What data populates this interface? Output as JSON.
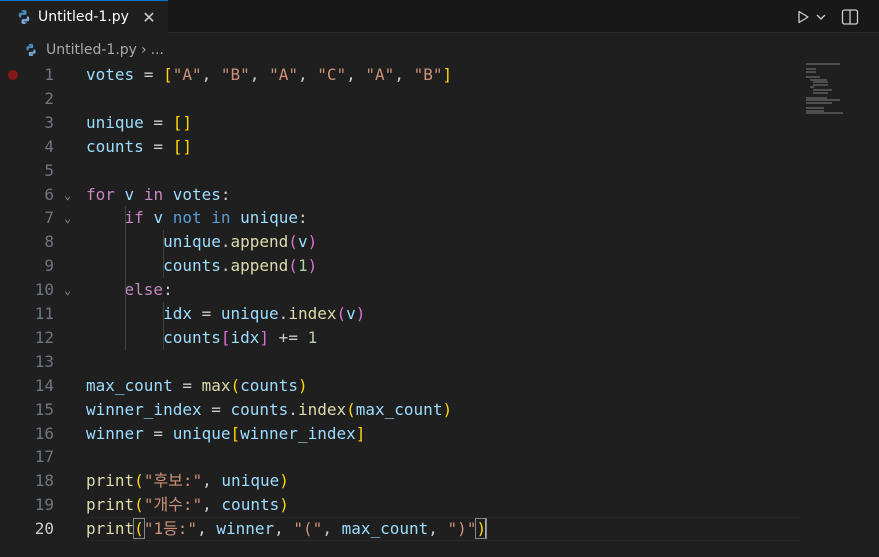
{
  "tab": {
    "title": "Untitled-1.py",
    "close_glyph": "✕",
    "active": true
  },
  "breadcrumb": {
    "file": "Untitled-1.py",
    "separator": "›",
    "more": "..."
  },
  "colors": {
    "accent": "#0078d4",
    "breakpoint": "#851818",
    "editor_bg": "#1f1f1f"
  },
  "icons": [
    "python-file-icon",
    "run-icon",
    "chevron-down-icon",
    "split-editor-icon",
    "close-icon",
    "fold-chevron-icon"
  ],
  "editor": {
    "breakpoint_line": 1,
    "current_line": 20,
    "lines": [
      {
        "n": "1",
        "fold": ""
      },
      {
        "n": "2",
        "fold": ""
      },
      {
        "n": "3",
        "fold": ""
      },
      {
        "n": "4",
        "fold": ""
      },
      {
        "n": "5",
        "fold": ""
      },
      {
        "n": "6",
        "fold": "⌄"
      },
      {
        "n": "7",
        "fold": "⌄"
      },
      {
        "n": "8",
        "fold": ""
      },
      {
        "n": "9",
        "fold": ""
      },
      {
        "n": "10",
        "fold": "⌄"
      },
      {
        "n": "11",
        "fold": ""
      },
      {
        "n": "12",
        "fold": ""
      },
      {
        "n": "13",
        "fold": ""
      },
      {
        "n": "14",
        "fold": ""
      },
      {
        "n": "15",
        "fold": ""
      },
      {
        "n": "16",
        "fold": ""
      },
      {
        "n": "17",
        "fold": ""
      },
      {
        "n": "18",
        "fold": ""
      },
      {
        "n": "19",
        "fold": ""
      },
      {
        "n": "20",
        "fold": ""
      }
    ],
    "code": [
      [
        [
          "var",
          "votes"
        ],
        [
          "p",
          " = "
        ],
        [
          "b1",
          "["
        ],
        [
          "str",
          "\"A\""
        ],
        [
          "p",
          ", "
        ],
        [
          "str",
          "\"B\""
        ],
        [
          "p",
          ", "
        ],
        [
          "str",
          "\"A\""
        ],
        [
          "p",
          ", "
        ],
        [
          "str",
          "\"C\""
        ],
        [
          "p",
          ", "
        ],
        [
          "str",
          "\"A\""
        ],
        [
          "p",
          ", "
        ],
        [
          "str",
          "\"B\""
        ],
        [
          "b1",
          "]"
        ]
      ],
      [],
      [
        [
          "var",
          "unique"
        ],
        [
          "p",
          " = "
        ],
        [
          "b1",
          "[]"
        ]
      ],
      [
        [
          "var",
          "counts"
        ],
        [
          "p",
          " = "
        ],
        [
          "b1",
          "[]"
        ]
      ],
      [],
      [
        [
          "ctl",
          "for"
        ],
        [
          "p",
          " "
        ],
        [
          "var",
          "v"
        ],
        [
          "p",
          " "
        ],
        [
          "ctl",
          "in"
        ],
        [
          "p",
          " "
        ],
        [
          "var",
          "votes"
        ],
        [
          "p",
          ":"
        ]
      ],
      [
        [
          "p",
          "    "
        ],
        [
          "ctl",
          "if"
        ],
        [
          "p",
          " "
        ],
        [
          "var",
          "v"
        ],
        [
          "p",
          " "
        ],
        [
          "op",
          "not"
        ],
        [
          "p",
          " "
        ],
        [
          "op",
          "in"
        ],
        [
          "p",
          " "
        ],
        [
          "var",
          "unique"
        ],
        [
          "p",
          ":"
        ]
      ],
      [
        [
          "p",
          "        "
        ],
        [
          "var",
          "unique"
        ],
        [
          "p",
          "."
        ],
        [
          "fn",
          "append"
        ],
        [
          "b2",
          "("
        ],
        [
          "var",
          "v"
        ],
        [
          "b2",
          ")"
        ]
      ],
      [
        [
          "p",
          "        "
        ],
        [
          "var",
          "counts"
        ],
        [
          "p",
          "."
        ],
        [
          "fn",
          "append"
        ],
        [
          "b2",
          "("
        ],
        [
          "num",
          "1"
        ],
        [
          "b2",
          ")"
        ]
      ],
      [
        [
          "p",
          "    "
        ],
        [
          "ctl",
          "else"
        ],
        [
          "p",
          ":"
        ]
      ],
      [
        [
          "p",
          "        "
        ],
        [
          "var",
          "idx"
        ],
        [
          "p",
          " = "
        ],
        [
          "var",
          "unique"
        ],
        [
          "p",
          "."
        ],
        [
          "fn",
          "index"
        ],
        [
          "b2",
          "("
        ],
        [
          "var",
          "v"
        ],
        [
          "b2",
          ")"
        ]
      ],
      [
        [
          "p",
          "        "
        ],
        [
          "var",
          "counts"
        ],
        [
          "b2",
          "["
        ],
        [
          "var",
          "idx"
        ],
        [
          "b2",
          "]"
        ],
        [
          "p",
          " += "
        ],
        [
          "num",
          "1"
        ]
      ],
      [],
      [
        [
          "var",
          "max_count"
        ],
        [
          "p",
          " = "
        ],
        [
          "fn",
          "max"
        ],
        [
          "b1",
          "("
        ],
        [
          "var",
          "counts"
        ],
        [
          "b1",
          ")"
        ]
      ],
      [
        [
          "var",
          "winner_index"
        ],
        [
          "p",
          " = "
        ],
        [
          "var",
          "counts"
        ],
        [
          "p",
          "."
        ],
        [
          "fn",
          "index"
        ],
        [
          "b1",
          "("
        ],
        [
          "var",
          "max_count"
        ],
        [
          "b1",
          ")"
        ]
      ],
      [
        [
          "var",
          "winner"
        ],
        [
          "p",
          " = "
        ],
        [
          "var",
          "unique"
        ],
        [
          "b1",
          "["
        ],
        [
          "var",
          "winner_index"
        ],
        [
          "b1",
          "]"
        ]
      ],
      [],
      [
        [
          "fn",
          "print"
        ],
        [
          "b1",
          "("
        ],
        [
          "str",
          "\"후보:\""
        ],
        [
          "p",
          ", "
        ],
        [
          "var",
          "unique"
        ],
        [
          "b1",
          ")"
        ]
      ],
      [
        [
          "fn",
          "print"
        ],
        [
          "b1",
          "("
        ],
        [
          "str",
          "\"개수:\""
        ],
        [
          "p",
          ", "
        ],
        [
          "var",
          "counts"
        ],
        [
          "b1",
          ")"
        ]
      ],
      [
        [
          "fn",
          "print"
        ],
        [
          "b1m",
          "("
        ],
        [
          "str",
          "\"1등:\""
        ],
        [
          "p",
          ", "
        ],
        [
          "var",
          "winner"
        ],
        [
          "p",
          ", "
        ],
        [
          "str",
          "\"(\""
        ],
        [
          "p",
          ", "
        ],
        [
          "var",
          "max_count"
        ],
        [
          "p",
          ", "
        ],
        [
          "str",
          "\")\""
        ],
        [
          "b1m",
          ")"
        ],
        [
          "cursor",
          ""
        ]
      ]
    ]
  }
}
